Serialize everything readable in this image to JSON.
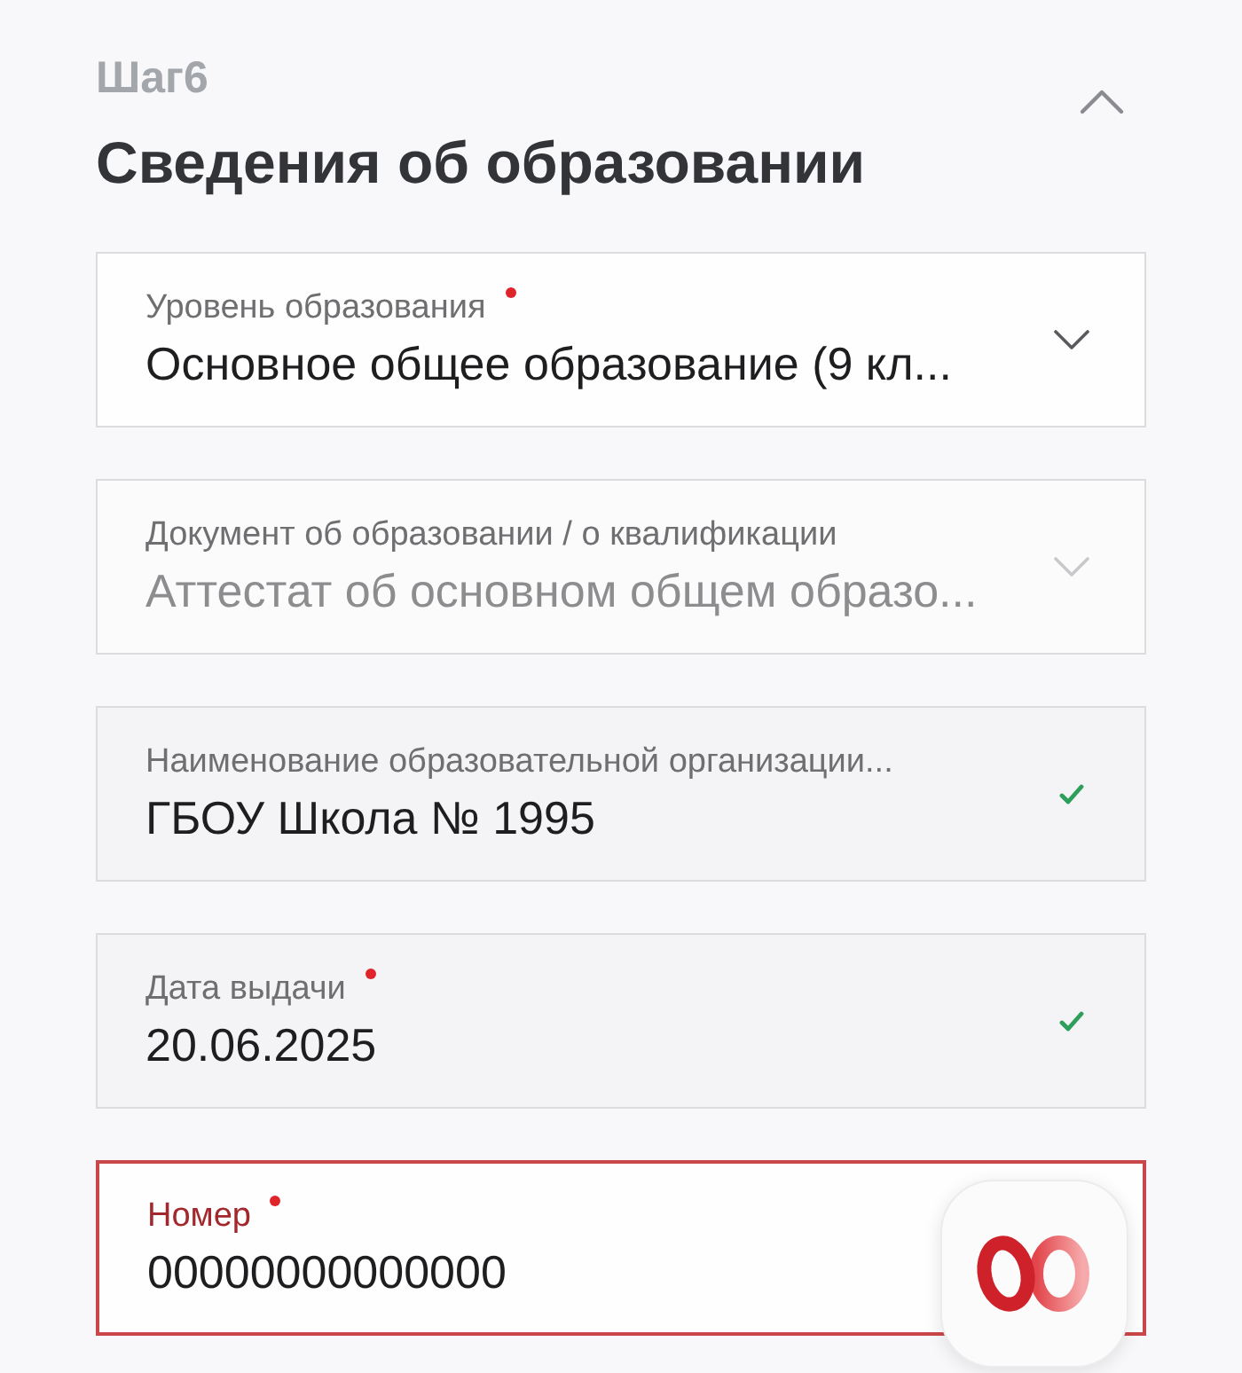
{
  "step": {
    "label": "Шаг6"
  },
  "section": {
    "title": "Сведения об образовании",
    "expanded": true
  },
  "fields": [
    {
      "kind": "select",
      "label": "Уровень образования",
      "required": true,
      "value": "Основное общее образование (9 кл...",
      "disabled": false,
      "valid": false,
      "error": false
    },
    {
      "kind": "select",
      "label": "Документ об образовании / о квалификации",
      "required": false,
      "value": "Аттестат об основном общем образо...",
      "disabled": true,
      "valid": false,
      "error": false
    },
    {
      "kind": "text",
      "label": "Наименование образовательной организации...",
      "required": false,
      "value": "ГБОУ Школа № 1995",
      "disabled": false,
      "valid": true,
      "error": false
    },
    {
      "kind": "text",
      "label": "Дата выдачи",
      "required": true,
      "value": "20.06.2025",
      "disabled": false,
      "valid": true,
      "error": false
    },
    {
      "kind": "text",
      "label": "Номер",
      "required": true,
      "value": "00000000000000",
      "disabled": false,
      "valid": false,
      "error": true
    }
  ]
}
